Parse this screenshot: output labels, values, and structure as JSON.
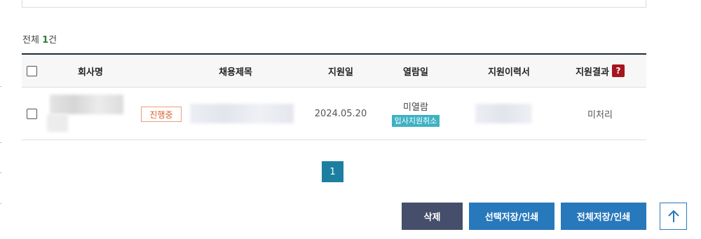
{
  "summary": {
    "prefix": "전체 ",
    "count": "1",
    "suffix": "건"
  },
  "columns": {
    "company": "회사명",
    "title": "채용제목",
    "apply_date": "지원일",
    "view": "열람일",
    "resume": "지원이력서",
    "result": "지원결과",
    "help_symbol": "?"
  },
  "rows": [
    {
      "status": "진행중",
      "apply_date": "2024.05.20",
      "view_status": "미열람",
      "cancel_label": "입사지원취소",
      "result": "미처리"
    }
  ],
  "pagination": {
    "current": "1"
  },
  "actions": {
    "delete": "삭제",
    "save_selected": "선택저장/인쇄",
    "save_all": "전체저장/인쇄"
  },
  "icons": {
    "scroll_top": "arrow-up-icon",
    "help": "question-icon"
  },
  "colors": {
    "header_border": "#1f2d3d",
    "status_badge": "#d9602e",
    "cancel_tag": "#3fb1c3",
    "pager": "#1d7fa0",
    "primary_button": "#2878bc",
    "delete_button": "#454f6b",
    "help_badge": "#a5161c"
  }
}
